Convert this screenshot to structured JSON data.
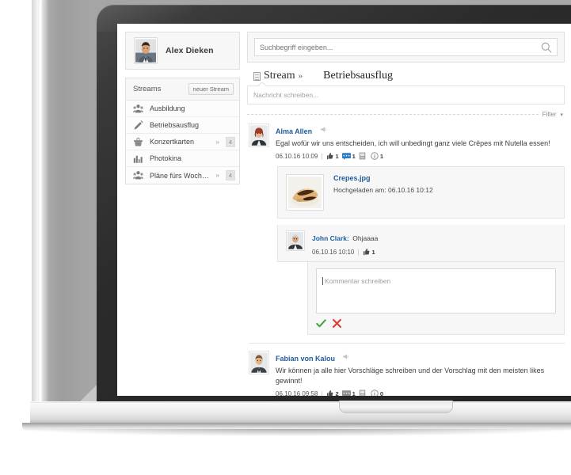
{
  "app": {
    "profile": {
      "name": "Alex Dieken",
      "avatar_icon": "user-photo-male"
    },
    "sidebar": {
      "header_title": "Streams",
      "new_stream_label": "neuer Stream",
      "items": [
        {
          "label": "Ausbildung",
          "icon": "people-group-icon",
          "chevron": "",
          "badge": ""
        },
        {
          "label": "Betriebsausflug",
          "icon": "pencil-icon",
          "chevron": "",
          "badge": ""
        },
        {
          "label": "Konzertkarten",
          "icon": "basket-icon",
          "chevron": "»",
          "badge": "4"
        },
        {
          "label": "Photokina",
          "icon": "bar-chart-icon",
          "chevron": "",
          "badge": ""
        },
        {
          "label": "Pläne fürs Wochenen...",
          "icon": "people-group-icon",
          "chevron": "»",
          "badge": "4"
        }
      ]
    },
    "search": {
      "placeholder": "Suchbegriff eingeben...",
      "value": "",
      "icon": "search-icon"
    },
    "tabs": {
      "stream_label": "Stream",
      "stream_chevron": "»",
      "active_label": "Betriebsausflug",
      "icon": "stream-page-icon"
    },
    "compose": {
      "placeholder": "Nachricht schreiben..."
    },
    "filter": {
      "label": "Filter",
      "caret": "▾"
    },
    "posts": [
      {
        "author": "Alma Allen",
        "author_badge_icon": "megaphone-icon",
        "text": "Egal wofür wir uns entscheiden, ich will unbedingt ganz viele Crêpes mit Nutella essen!",
        "timestamp": "06.10.16 10:09",
        "separator": "|",
        "likes": "1",
        "comments": "1",
        "attachments": "",
        "views": "1",
        "avatar_icon": "user-photo-female-red",
        "attachment": {
          "filename": "Crepes.jpg",
          "uploaded_label": "Hochgeladen am: 06.10.16 10:12",
          "thumb_icon": "crepes-photo"
        },
        "comment": {
          "author": "John Clark",
          "separator_colon": ":",
          "text": "Ohjaaaa",
          "timestamp": "06.10.16 10:10",
          "meta_separator": "|",
          "likes": "1",
          "avatar_icon": "user-photo-male-senior"
        },
        "reply": {
          "placeholder": "Kommentar schreiben",
          "confirm_icon": "check-icon",
          "cancel_icon": "x-icon"
        }
      },
      {
        "author": "Fabian von Kalou",
        "author_badge_icon": "megaphone-icon",
        "text": "Wir können ja alle hier Vorschläge schreiben und der Vorschlag mit den meisten likes gewinnt!",
        "timestamp": "06.10.16 09:58",
        "separator": "|",
        "likes": "2",
        "comments": "1",
        "attachments": "",
        "views": "0",
        "avatar_icon": "user-photo-male-blond"
      }
    ],
    "colors": {
      "link": "#1f5c9e",
      "panel_bg": "#f7f7f7",
      "border": "#e0e0e0",
      "confirm_green": "#3aa33a",
      "cancel_red": "#e03b2f",
      "comment_badge_blue": "#2d7ac4"
    }
  }
}
